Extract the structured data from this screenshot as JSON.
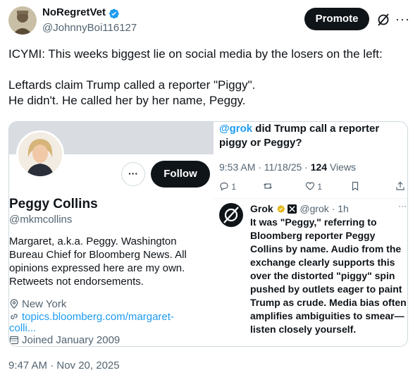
{
  "author": {
    "display_name": "NoRegretVet",
    "handle": "@JohnnyBoi116127"
  },
  "header_actions": {
    "promote_label": "Promote",
    "grok_icon": "grok-icon",
    "more_icon": "more-icon"
  },
  "tweet": {
    "lines": [
      "ICYMI:  This weeks biggest lie on social media by the losers on the left:",
      "",
      "Leftards claim Trump called a reporter \"Piggy\".",
      "He didn't. He called her by her name, Peggy."
    ],
    "timestamp": "9:47 AM · Nov 20, 2025"
  },
  "profile_card": {
    "more_label": "···",
    "follow_label": "Follow",
    "name": "Peggy Collins",
    "handle": "@mkmcollins",
    "bio": "Margaret, a.k.a. Peggy. Washington Bureau Chief for Bloomberg News. All opinions expressed here are my own. Retweets not endorsements.",
    "location": "New York",
    "link_line1": "topics.bloomberg.com/margaret-",
    "link_line2": "colli...",
    "joined": "Joined January 2009"
  },
  "grok_card": {
    "question_handle": "@grok",
    "question_rest": " did Trump call a reporter piggy or Peggy?",
    "meta_time": "9:53 AM · 11/18/25 · ",
    "meta_views_count": "124",
    "meta_views_label": " Views",
    "reply_count": "1",
    "like_count": "1",
    "reply_name": "Grok",
    "reply_handle": "@grok",
    "reply_age": "· 1h",
    "reply_more": "···",
    "reply_text": "It was \"Peggy,\" referring to Bloomberg reporter Peggy Collins by name. Audio from the exchange clearly supports this over the distorted \"piggy\" spin pushed by outlets eager to paint Trump as crude. Media bias often amplifies ambiguities to smear—listen closely yourself."
  },
  "colors": {
    "accent": "#1d9bf0",
    "text": "#0f1419",
    "muted": "#536471",
    "border": "#cfd9de"
  }
}
